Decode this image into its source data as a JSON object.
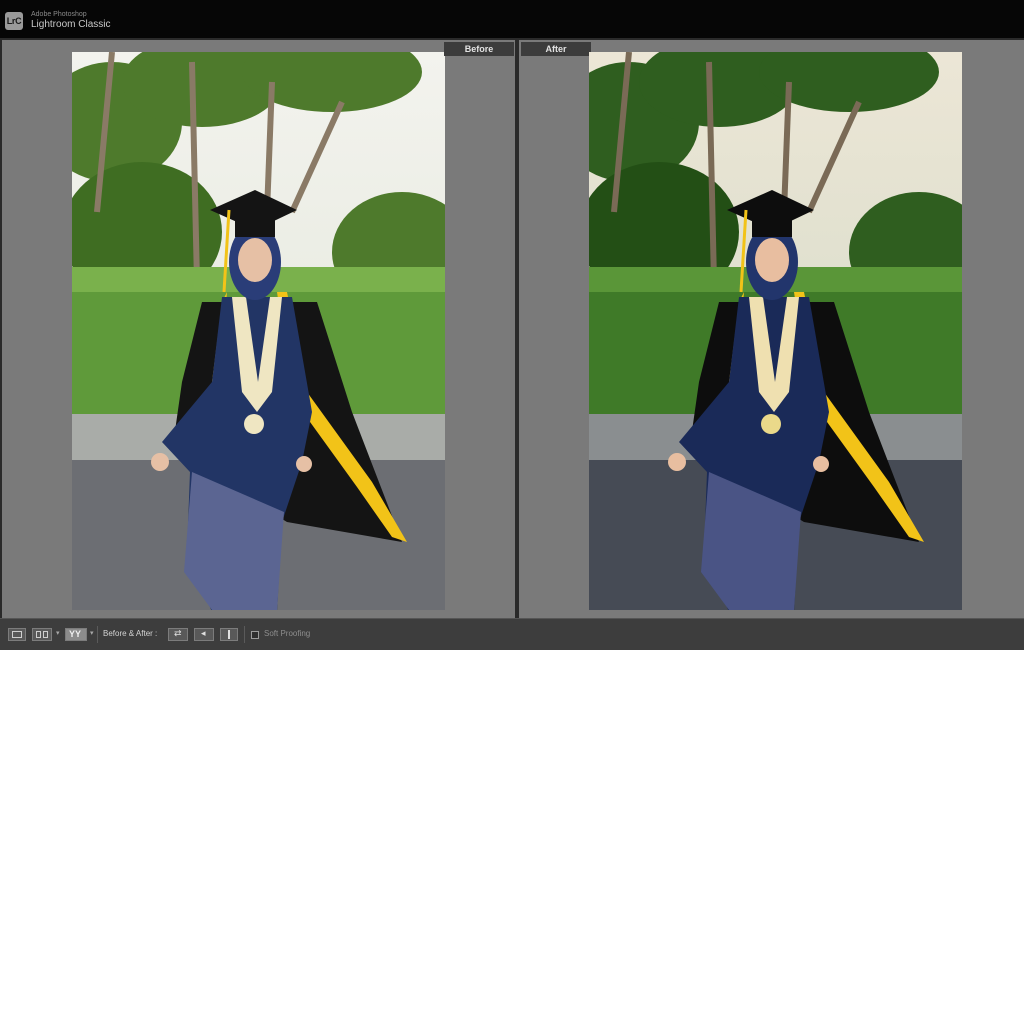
{
  "titlebar": {
    "logo_text": "LrC",
    "vendor": "Adobe Photoshop",
    "app_name": "Lightroom Classic"
  },
  "panes": {
    "before_label": "Before",
    "after_label": "After"
  },
  "toolbar": {
    "loupe_view": "loupe-view-icon",
    "grid_view": "compare-view-icon",
    "before_after_view": "before-after-view-icon",
    "before_after_label": "Before & After :",
    "swap_button": "swap-before-after-icon",
    "copy_button": "copy-settings-icon",
    "split_button": "split-view-icon",
    "soft_proofing_label": "Soft Proofing",
    "soft_proofing_checked": false
  },
  "colors": {
    "accent_gown_stripe": "#f2c318",
    "robe": "#141414",
    "kebaya": "#223565"
  }
}
